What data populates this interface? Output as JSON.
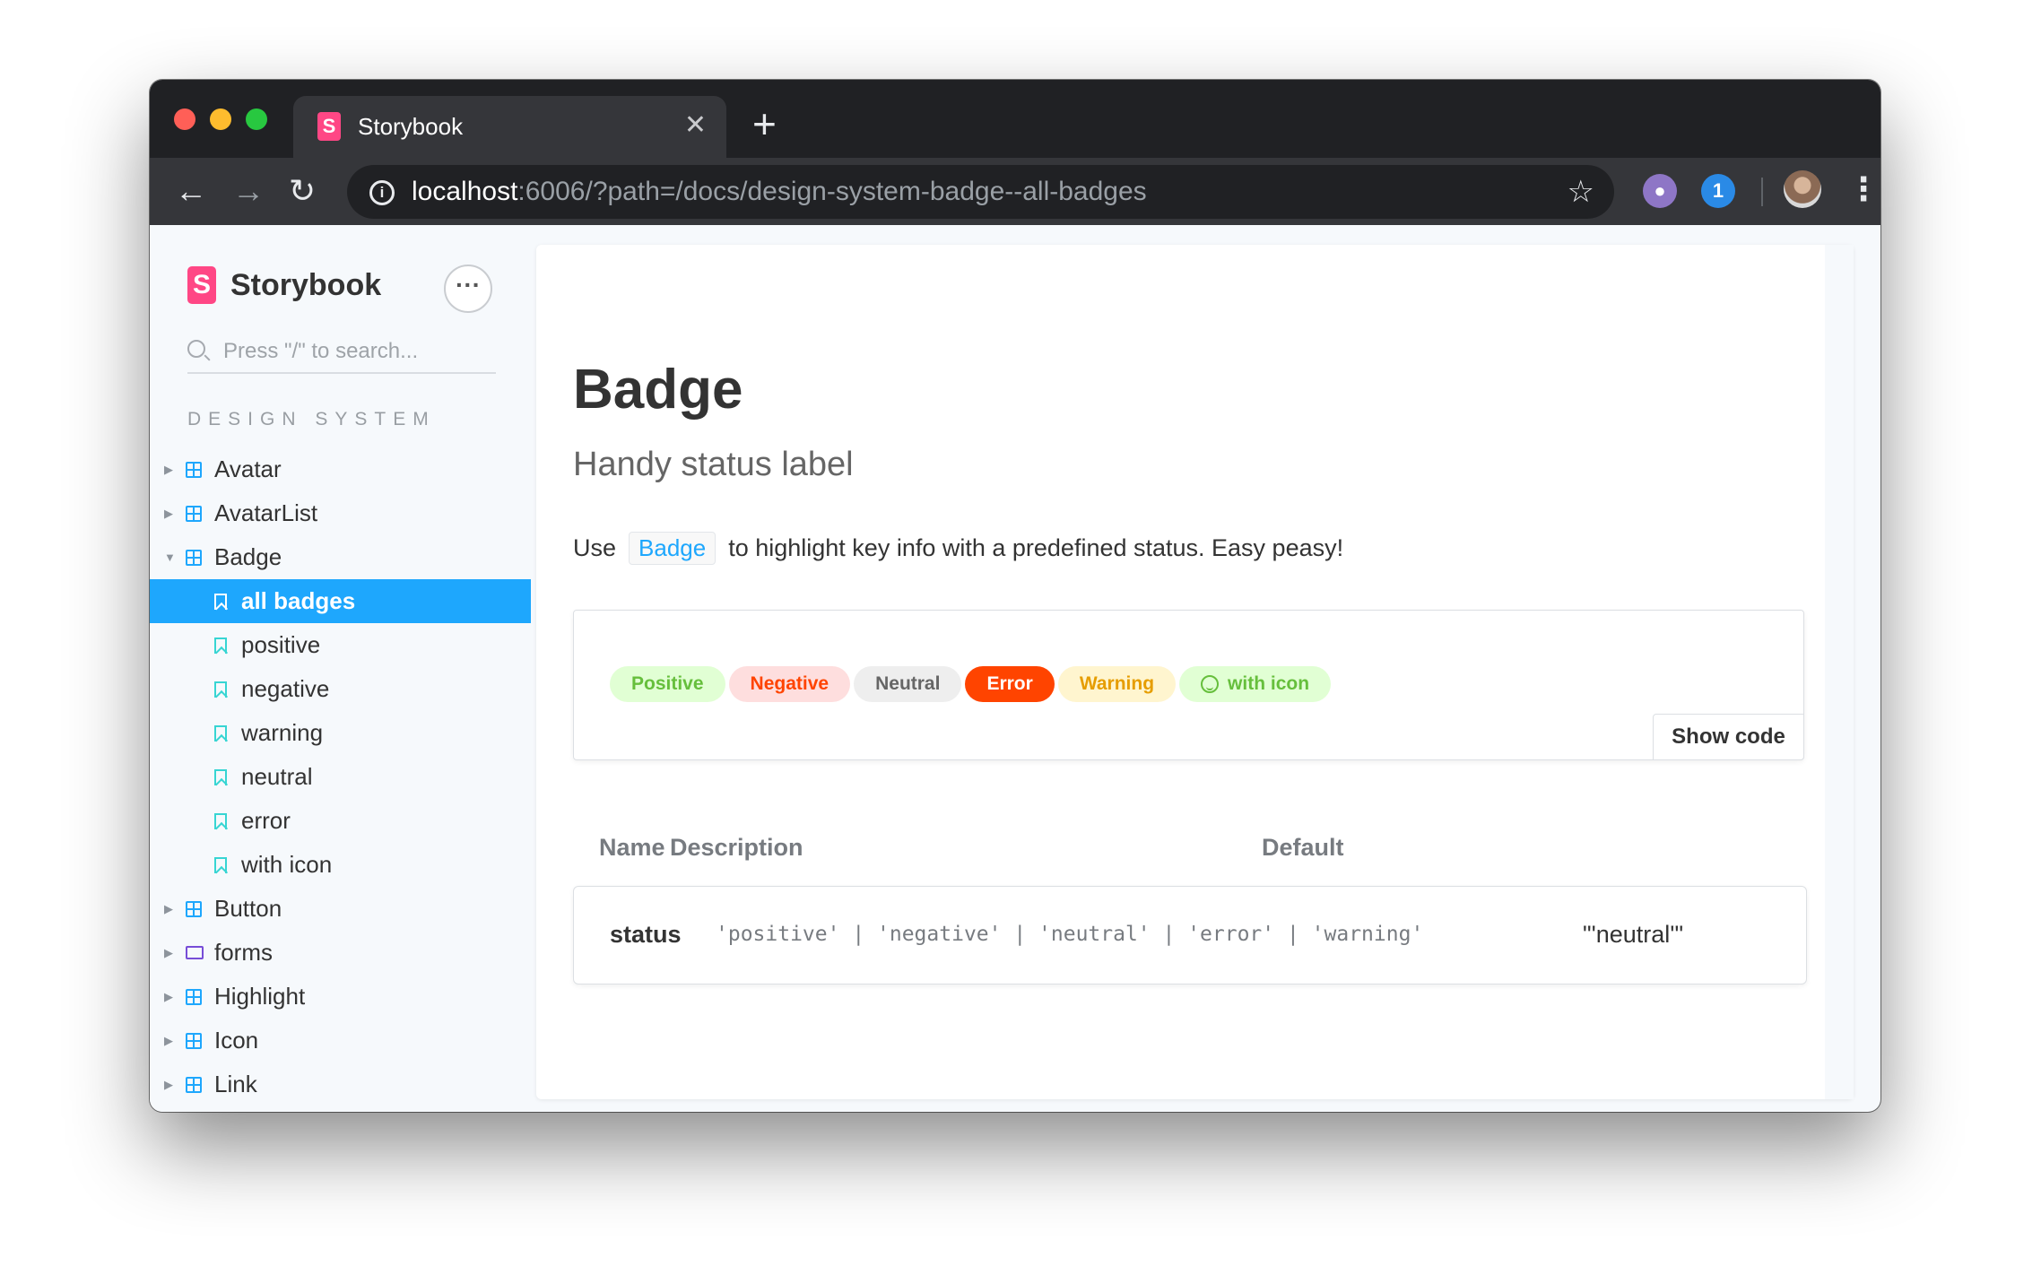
{
  "browser": {
    "tab_title": "Storybook",
    "tab_close": "✕",
    "new_tab": "+",
    "url_host": "localhost",
    "url_rest": ":6006/?path=/docs/design-system-badge--all-badges",
    "icons": [
      "back-arrow-icon",
      "forward-arrow-icon",
      "reload-icon",
      "info-icon",
      "star-icon",
      "github-extension-icon",
      "onepassword-extension-icon",
      "profile-avatar",
      "kebab-menu-icon"
    ]
  },
  "sidebar": {
    "brand": "Storybook",
    "search_placeholder": "Press \"/\" to search...",
    "section_title": "DESIGN SYSTEM",
    "items": [
      {
        "label": "Avatar",
        "type": "component",
        "expanded": false
      },
      {
        "label": "AvatarList",
        "type": "component",
        "expanded": false
      },
      {
        "label": "Badge",
        "type": "component",
        "expanded": true
      },
      {
        "label": "all badges",
        "type": "story",
        "selected": true
      },
      {
        "label": "positive",
        "type": "story"
      },
      {
        "label": "negative",
        "type": "story"
      },
      {
        "label": "warning",
        "type": "story"
      },
      {
        "label": "neutral",
        "type": "story"
      },
      {
        "label": "error",
        "type": "story"
      },
      {
        "label": "with icon",
        "type": "story"
      },
      {
        "label": "Button",
        "type": "component",
        "expanded": false
      },
      {
        "label": "forms",
        "type": "folder",
        "expanded": false
      },
      {
        "label": "Highlight",
        "type": "component",
        "expanded": false
      },
      {
        "label": "Icon",
        "type": "component",
        "expanded": false
      },
      {
        "label": "Link",
        "type": "component",
        "expanded": false
      }
    ]
  },
  "doc": {
    "title": "Badge",
    "subtitle": "Handy status label",
    "desc_prefix": "Use",
    "desc_code": "Badge",
    "desc_suffix": "to highlight key info with a predefined status. Easy peasy!",
    "badges": [
      {
        "label": "Positive",
        "status": "positive"
      },
      {
        "label": "Negative",
        "status": "negative"
      },
      {
        "label": "Neutral",
        "status": "neutral"
      },
      {
        "label": "Error",
        "status": "error"
      },
      {
        "label": "Warning",
        "status": "warning"
      },
      {
        "label": "with icon",
        "status": "positive",
        "icon": "smiley-icon"
      }
    ],
    "show_code": "Show code",
    "props": {
      "headers": [
        "Name",
        "Description",
        "Default"
      ],
      "rows": [
        {
          "name": "status",
          "type": "'positive' | 'negative' | 'neutral' | 'error' | 'warning'",
          "default": "\"'neutral'\""
        }
      ]
    }
  },
  "colors": {
    "accent": "#1ea7fd",
    "storybook_pink": "#ff4785",
    "positive": "#66bf3c",
    "negative": "#ff4400",
    "warning": "#e69d00"
  }
}
